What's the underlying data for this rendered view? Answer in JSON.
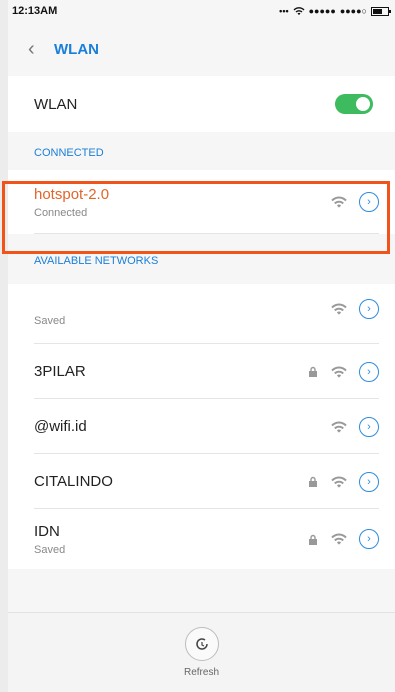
{
  "status_bar": {
    "time": "12:13AM",
    "signal_text": "... ",
    "battery_level": 0.6
  },
  "appbar": {
    "title": "WLAN"
  },
  "wlan_toggle": {
    "label": "WLAN",
    "enabled": true
  },
  "connected": {
    "header": "CONNECTED",
    "network": {
      "name": "hotspot-2.0",
      "status": "Connected"
    }
  },
  "available": {
    "header": "AVAILABLE NETWORKS",
    "networks": [
      {
        "name": "",
        "sub": "Saved",
        "locked": false
      },
      {
        "name": "3PILAR",
        "sub": "",
        "locked": true
      },
      {
        "name": "@wifi.id",
        "sub": "",
        "locked": false
      },
      {
        "name": "CITALINDO",
        "sub": "",
        "locked": true
      },
      {
        "name": "IDN",
        "sub": "Saved",
        "locked": true
      }
    ]
  },
  "bottom": {
    "refresh_label": "Refresh"
  },
  "colors": {
    "accent": "#1a7fd8",
    "connected_name": "#e2652a",
    "toggle_on": "#3dbb5e",
    "highlight": "#f0541b"
  }
}
